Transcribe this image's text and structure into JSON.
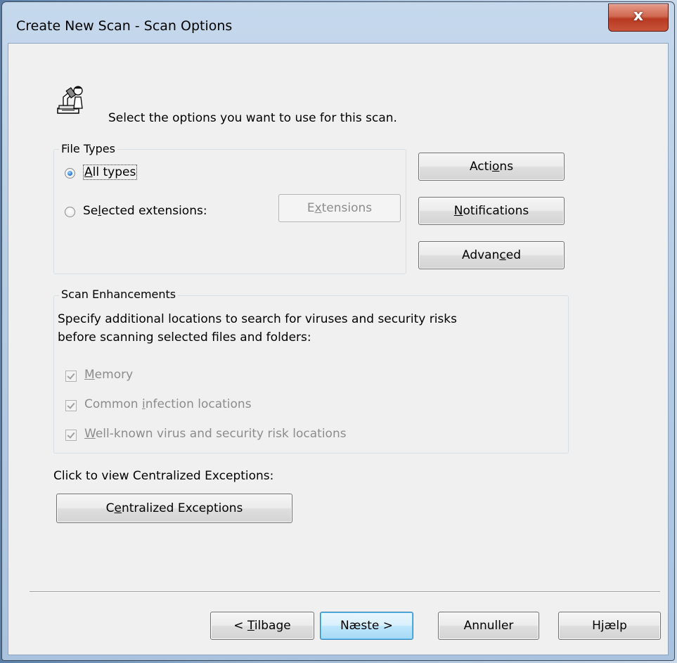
{
  "window": {
    "title": "Create New Scan - Scan Options",
    "close_label": "x"
  },
  "header": {
    "icon": "scan-options-icon",
    "instruction": "Select the options you want to use for this scan."
  },
  "file_types": {
    "legend": "File Types",
    "all_types_label": "All types",
    "selected_extensions_label": "Selected extensions:",
    "extensions_button": "Extensions",
    "selected": "all_types"
  },
  "side_buttons": {
    "actions": "Actions",
    "notifications": "Notifications",
    "advanced": "Advanced"
  },
  "scan_enhancements": {
    "legend": "Scan Enhancements",
    "description_line1": "Specify additional locations to search for viruses and security risks",
    "description_line2": "before scanning selected files and folders:",
    "options": [
      {
        "label": "Memory",
        "checked": true,
        "enabled": false
      },
      {
        "label": "Common infection locations",
        "checked": true,
        "enabled": false
      },
      {
        "label": "Well-known virus and security risk locations",
        "checked": true,
        "enabled": false
      }
    ]
  },
  "exceptions": {
    "prompt": "Click to view Centralized Exceptions:",
    "button": "Centralized Exceptions"
  },
  "footer": {
    "back": "< Tilbage",
    "next": "Næste >",
    "cancel": "Annuller",
    "help": "Hjælp"
  }
}
